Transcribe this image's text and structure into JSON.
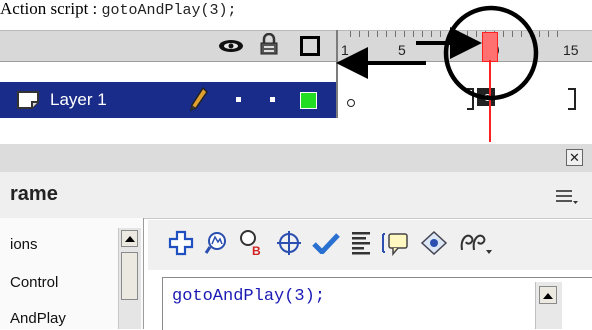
{
  "caption": {
    "prefix": "Action script :",
    "code": "gotoAndPlay(3);"
  },
  "timeline": {
    "frame_numbers": [
      "1",
      "5",
      "10",
      "15"
    ],
    "layer": {
      "name": "Layer 1"
    },
    "playhead_frame": 10
  },
  "actions_panel": {
    "title": "rame",
    "list_items": [
      "ions",
      "Control",
      "AndPlay"
    ],
    "code": "gotoAndPlay(3);"
  },
  "colors": {
    "layer_highlight": "#1a2c8a",
    "playhead": "#ff2020",
    "keyframe_green": "#22dd22",
    "code_text": "#1a1ab4",
    "annotation": "#000000"
  },
  "icons": {
    "eye": "eye-icon",
    "lock": "lock-icon",
    "outline": "outline-square-icon",
    "layer": "layer-icon",
    "pencil": "pencil-icon",
    "toolbar": [
      "add-statement-icon",
      "find-icon",
      "replace-icon",
      "target-path-icon",
      "check-syntax-icon",
      "auto-format-icon",
      "code-hint-icon",
      "debug-options-icon",
      "view-options-icon"
    ]
  }
}
